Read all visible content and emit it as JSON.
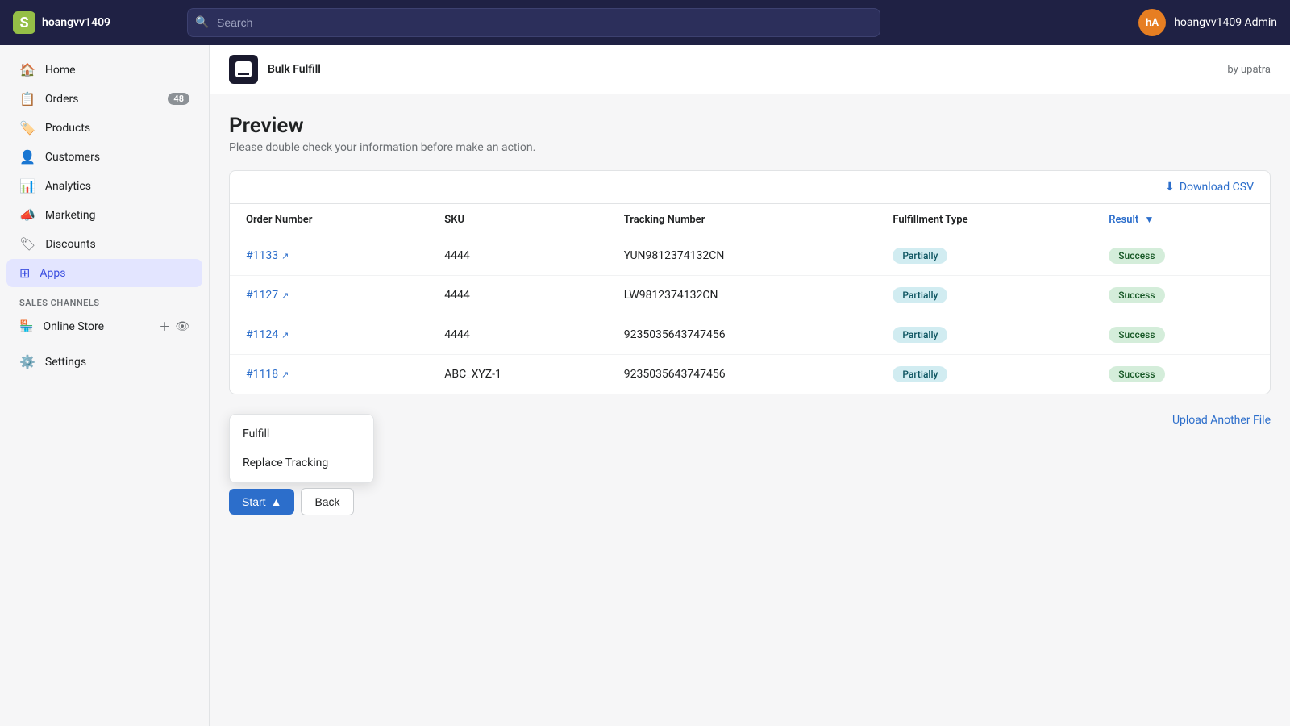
{
  "topbar": {
    "logo_text": "hoangvv1409",
    "search_placeholder": "Search",
    "user_initials": "hA",
    "user_name": "hoangvv1409 Admin"
  },
  "sidebar": {
    "nav_items": [
      {
        "id": "home",
        "label": "Home",
        "icon": "🏠",
        "badge": null,
        "active": false
      },
      {
        "id": "orders",
        "label": "Orders",
        "icon": "📋",
        "badge": "48",
        "active": false
      },
      {
        "id": "products",
        "label": "Products",
        "icon": "🏷️",
        "badge": null,
        "active": false
      },
      {
        "id": "customers",
        "label": "Customers",
        "icon": "👤",
        "badge": null,
        "active": false
      },
      {
        "id": "analytics",
        "label": "Analytics",
        "icon": "📊",
        "badge": null,
        "active": false
      },
      {
        "id": "marketing",
        "label": "Marketing",
        "icon": "📣",
        "badge": null,
        "active": false
      },
      {
        "id": "discounts",
        "label": "Discounts",
        "icon": "🏷",
        "badge": null,
        "active": false
      },
      {
        "id": "apps",
        "label": "Apps",
        "icon": "⊞",
        "badge": null,
        "active": true
      }
    ],
    "sales_channels_label": "SALES CHANNELS",
    "online_store_label": "Online Store",
    "settings_label": "Settings"
  },
  "app_header": {
    "app_name": "Bulk Fulfill",
    "by_label": "by upatra"
  },
  "preview": {
    "title": "Preview",
    "subtitle": "Please double check your information before make an action.",
    "download_csv_label": "Download CSV",
    "table": {
      "columns": [
        {
          "id": "order_number",
          "label": "Order Number"
        },
        {
          "id": "sku",
          "label": "SKU"
        },
        {
          "id": "tracking_number",
          "label": "Tracking Number"
        },
        {
          "id": "fulfillment_type",
          "label": "Fulfillment Type"
        },
        {
          "id": "result",
          "label": "Result"
        }
      ],
      "rows": [
        {
          "order_number": "#1133",
          "sku": "4444",
          "tracking_number": "YUN9812374132CN",
          "fulfillment_type": "Partially",
          "result": "Success"
        },
        {
          "order_number": "#1127",
          "sku": "4444",
          "tracking_number": "LW9812374132CN",
          "fulfillment_type": "Partially",
          "result": "Success"
        },
        {
          "order_number": "#1124",
          "sku": "4444",
          "tracking_number": "9235035643747456",
          "fulfillment_type": "Partially",
          "result": "Success"
        },
        {
          "order_number": "#1118",
          "sku": "ABC_XYZ-1",
          "tracking_number": "9235035643747456",
          "fulfillment_type": "Partially",
          "result": "Success"
        }
      ]
    }
  },
  "dropdown": {
    "items": [
      {
        "label": "Fulfill"
      },
      {
        "label": "Replace Tracking"
      }
    ]
  },
  "buttons": {
    "start_label": "Start",
    "back_label": "Back",
    "upload_another_label": "Upload Another File"
  }
}
